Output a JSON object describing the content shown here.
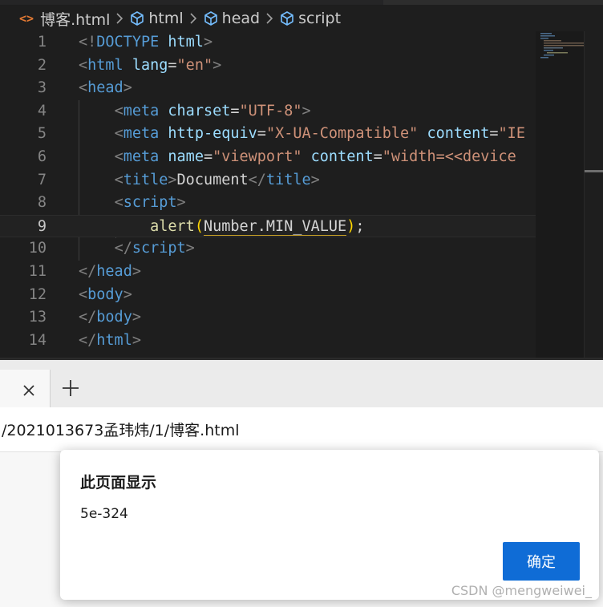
{
  "editor": {
    "breadcrumb": {
      "file_icon": "<>",
      "file_name": "博客.html",
      "symbols": [
        "html",
        "head",
        "script"
      ]
    },
    "lines": [
      {
        "num": "1",
        "tokens": [
          [
            "ang",
            "<!"
          ],
          [
            "tag",
            "DOCTYPE"
          ],
          [
            "txt",
            " "
          ],
          [
            "attr",
            "html"
          ],
          [
            "ang",
            ">"
          ]
        ]
      },
      {
        "num": "2",
        "tokens": [
          [
            "ang",
            "<"
          ],
          [
            "tag",
            "html"
          ],
          [
            "txt",
            " "
          ],
          [
            "attr",
            "lang"
          ],
          [
            "txt",
            "="
          ],
          [
            "str",
            "\"en\""
          ],
          [
            "ang",
            ">"
          ]
        ]
      },
      {
        "num": "3",
        "tokens": [
          [
            "ang",
            "<"
          ],
          [
            "tag",
            "head"
          ],
          [
            "ang",
            ">"
          ]
        ]
      },
      {
        "num": "4",
        "tokens": [
          [
            "txt",
            "    "
          ],
          [
            "ang",
            "<"
          ],
          [
            "tag",
            "meta"
          ],
          [
            "txt",
            " "
          ],
          [
            "attr",
            "charset"
          ],
          [
            "txt",
            "="
          ],
          [
            "str",
            "\"UTF-8\""
          ],
          [
            "ang",
            ">"
          ]
        ]
      },
      {
        "num": "5",
        "tokens": [
          [
            "txt",
            "    "
          ],
          [
            "ang",
            "<"
          ],
          [
            "tag",
            "meta"
          ],
          [
            "txt",
            " "
          ],
          [
            "attr",
            "http-equiv"
          ],
          [
            "txt",
            "="
          ],
          [
            "str",
            "\"X-UA-Compatible\""
          ],
          [
            "txt",
            " "
          ],
          [
            "attr",
            "content"
          ],
          [
            "txt",
            "="
          ],
          [
            "str",
            "\"IE"
          ]
        ]
      },
      {
        "num": "6",
        "tokens": [
          [
            "txt",
            "    "
          ],
          [
            "ang",
            "<"
          ],
          [
            "tag",
            "meta"
          ],
          [
            "txt",
            " "
          ],
          [
            "attr",
            "name"
          ],
          [
            "txt",
            "="
          ],
          [
            "str",
            "\"viewport\""
          ],
          [
            "txt",
            " "
          ],
          [
            "attr",
            "content"
          ],
          [
            "txt",
            "="
          ],
          [
            "str",
            "\"width=<<device"
          ]
        ]
      },
      {
        "num": "7",
        "tokens": [
          [
            "txt",
            "    "
          ],
          [
            "ang",
            "<"
          ],
          [
            "tag",
            "title"
          ],
          [
            "ang",
            ">"
          ],
          [
            "txt",
            "Document"
          ],
          [
            "ang",
            "</"
          ],
          [
            "tag",
            "title"
          ],
          [
            "ang",
            ">"
          ]
        ]
      },
      {
        "num": "8",
        "tokens": [
          [
            "txt",
            "    "
          ],
          [
            "ang",
            "<"
          ],
          [
            "tag",
            "script"
          ],
          [
            "ang",
            ">"
          ]
        ]
      },
      {
        "num": "9",
        "tokens": [
          [
            "txt",
            "        "
          ],
          [
            "fn",
            "alert"
          ],
          [
            "paren",
            "("
          ],
          [
            "txt",
            "Number.MIN_VALUE"
          ],
          [
            "paren",
            ")"
          ],
          [
            "txt",
            ";"
          ]
        ],
        "current": true
      },
      {
        "num": "10",
        "tokens": [
          [
            "txt",
            "    "
          ],
          [
            "ang",
            "</"
          ],
          [
            "tag",
            "script"
          ],
          [
            "ang",
            ">"
          ]
        ]
      },
      {
        "num": "11",
        "tokens": [
          [
            "ang",
            "</"
          ],
          [
            "tag",
            "head"
          ],
          [
            "ang",
            ">"
          ]
        ]
      },
      {
        "num": "12",
        "tokens": [
          [
            "ang",
            "<"
          ],
          [
            "tag",
            "body"
          ],
          [
            "ang",
            ">"
          ]
        ]
      },
      {
        "num": "13",
        "tokens": [
          [
            "ang",
            "</"
          ],
          [
            "tag",
            "body"
          ],
          [
            "ang",
            ">"
          ]
        ]
      },
      {
        "num": "14",
        "tokens": [
          [
            "ang",
            "</"
          ],
          [
            "tag",
            "html"
          ],
          [
            "ang",
            ">"
          ]
        ]
      }
    ]
  },
  "browser": {
    "tab": {
      "close_icon": "close-icon"
    },
    "new_tab_icon": "plus-icon",
    "url": "/2021013673孟玮炜/1/博客.html"
  },
  "dialog": {
    "title": "此页面显示",
    "message": "5e-324",
    "ok_label": "确定"
  },
  "watermark": "CSDN @mengweiwei_",
  "colors": {
    "editor_bg": "#1e1e1e",
    "tag": "#569cd6",
    "attr": "#9cdcfe",
    "string": "#ce9178",
    "function": "#dcdcaa",
    "bracket": "#ffd700",
    "button": "#0f6cd6"
  }
}
